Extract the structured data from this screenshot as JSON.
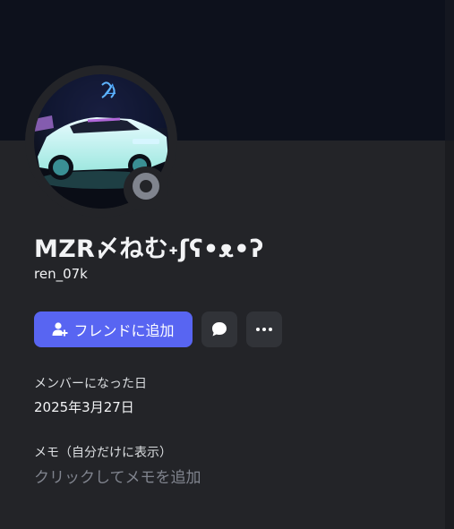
{
  "profile": {
    "display_name": "MZR〆ねむ˖ʃʕ•ᴥ•ʔ",
    "username": "ren_07k",
    "status": "offline"
  },
  "actions": {
    "add_friend_label": "フレンドに追加",
    "add_friend_icon": "person-add-icon",
    "message_icon": "speech-bubble-icon",
    "more_icon": "ellipsis-icon"
  },
  "member_since": {
    "label": "メンバーになった日",
    "value": "2025年3月27日"
  },
  "note": {
    "label": "メモ（自分だけに表示）",
    "placeholder": "クリックしてメモを追加"
  },
  "colors": {
    "banner": "#0d111c",
    "panel": "#232428",
    "accent": "#5865f2",
    "status_offline": "#80848e"
  }
}
